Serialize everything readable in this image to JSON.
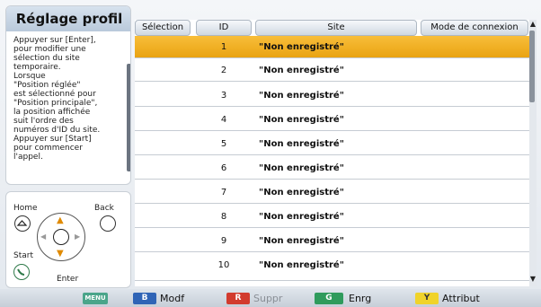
{
  "left_panel": {
    "title": "Réglage profil",
    "help_text": "Appuyer sur [Enter],\npour modifier une\nsélection du site\ntemporaire.\nLorsque\n\"Position réglée\"\nest sélectionné pour\n\"Position principale\",\nla position affichée\nsuit l'ordre des\nnuméros d'ID du site.\nAppuyer sur [Start]\npour commencer\nl'appel."
  },
  "remote": {
    "home_label": "Home",
    "back_label": "Back",
    "start_label": "Start",
    "enter_label": "Enter"
  },
  "table": {
    "columns": [
      "Sélection",
      "ID",
      "Site",
      "Mode de connexion"
    ],
    "selected_row": 0,
    "rows": [
      {
        "id": "1",
        "site": "\"Non enregistré\""
      },
      {
        "id": "2",
        "site": "\"Non enregistré\""
      },
      {
        "id": "3",
        "site": "\"Non enregistré\""
      },
      {
        "id": "4",
        "site": "\"Non enregistré\""
      },
      {
        "id": "5",
        "site": "\"Non enregistré\""
      },
      {
        "id": "6",
        "site": "\"Non enregistré\""
      },
      {
        "id": "7",
        "site": "\"Non enregistré\""
      },
      {
        "id": "8",
        "site": "\"Non enregistré\""
      },
      {
        "id": "9",
        "site": "\"Non enregistré\""
      },
      {
        "id": "10",
        "site": "\"Non enregistré\""
      }
    ]
  },
  "bottom_bar": {
    "menu_key": "MENU",
    "b_key": "B",
    "b_label": "Modf",
    "r_key": "R",
    "r_label": "Suppr",
    "g_key": "G",
    "g_label": "Enrg",
    "y_key": "Y",
    "y_label": "Attribut"
  },
  "colors": {
    "selected_row": "#f2b026",
    "menu_key": "#4aa58a",
    "b_key": "#2f64b6",
    "r_key": "#d23b2e",
    "g_key": "#2f9b5c",
    "y_key": "#f0d32a"
  },
  "icons": {
    "home": "home-icon",
    "back": "back-icon",
    "start": "start-icon",
    "dpad": "dpad-icon"
  }
}
